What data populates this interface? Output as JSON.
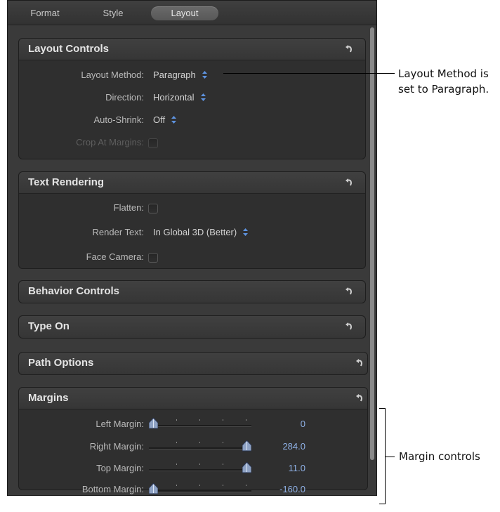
{
  "tabs": [
    {
      "label": "Format",
      "active": false
    },
    {
      "label": "Style",
      "active": false
    },
    {
      "label": "Layout",
      "active": true
    }
  ],
  "groups": {
    "layout_controls": {
      "title": "Layout Controls",
      "rows": [
        {
          "label": "Layout Method:",
          "value": "Paragraph"
        },
        {
          "label": "Direction:",
          "value": "Horizontal"
        },
        {
          "label": "Auto-Shrink:",
          "value": "Off"
        },
        {
          "label": "Crop At Margins:",
          "checked": false,
          "disabled": true
        }
      ]
    },
    "text_rendering": {
      "title": "Text Rendering",
      "rows": [
        {
          "label": "Flatten:",
          "checked": false
        },
        {
          "label": "Render Text:",
          "value": "In Global 3D (Better)"
        },
        {
          "label": "Face Camera:",
          "checked": false
        }
      ]
    },
    "behavior_controls": {
      "title": "Behavior Controls"
    },
    "type_on": {
      "title": "Type On"
    },
    "path_options": {
      "title": "Path Options"
    },
    "margins": {
      "title": "Margins",
      "rows": [
        {
          "label": "Left Margin:",
          "value": "0",
          "slider_fraction": 0.0
        },
        {
          "label": "Right Margin:",
          "value": "284.0",
          "slider_fraction": 1.0
        },
        {
          "label": "Top Margin:",
          "value": "11.0",
          "slider_fraction": 1.0
        },
        {
          "label": "Bottom Margin:",
          "value": "-160.0",
          "slider_fraction": 0.0
        }
      ]
    }
  },
  "annotations": {
    "layout_method_line1": "Layout Method is",
    "layout_method_line2": "set to Paragraph.",
    "margin_controls": "Margin controls"
  },
  "colors": {
    "panel_bg": "#3a3a3a",
    "group_bg": "#2f2f2f",
    "label": "#b9b9b9",
    "value": "#d3d3d3",
    "slider_value": "#8fb1e6",
    "stepper_accent": "#5e93e0"
  },
  "icons": {
    "reset": "reset-arrow-icon",
    "stepper": "stepper-updown-icon",
    "slider_thumb": "slider-thumb-icon"
  }
}
